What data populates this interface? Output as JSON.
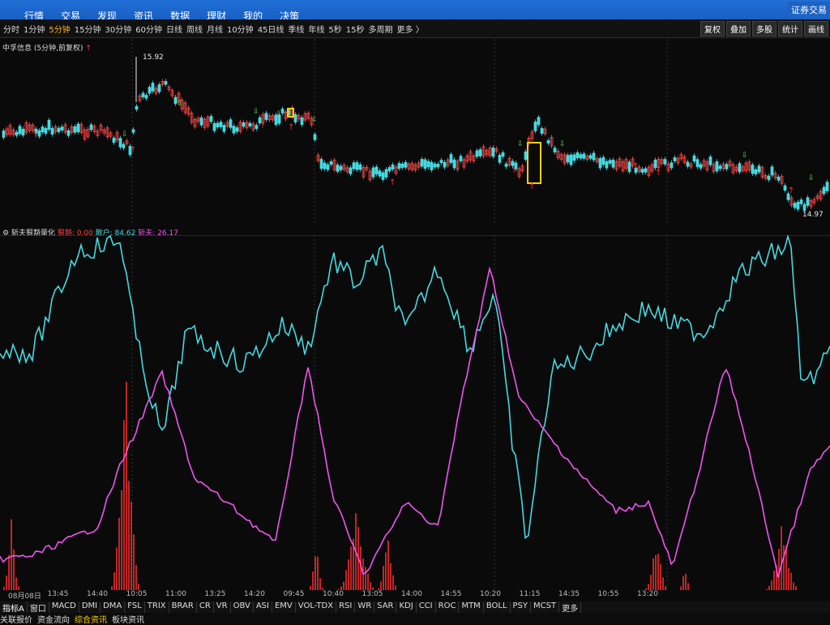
{
  "app": {
    "menu": [
      "行情",
      "交易",
      "发现",
      "资讯",
      "数据",
      "理财",
      "我的",
      "决策"
    ],
    "brand": "证券交易"
  },
  "toolbar": {
    "periods": [
      "分时",
      "1分钟",
      "5分钟",
      "15分钟",
      "30分钟",
      "60分钟",
      "日线",
      "周线",
      "月线",
      "10分钟",
      "45日线",
      "季线",
      "年线",
      "5秒",
      "15秒",
      "多周期",
      "更多 〉"
    ],
    "active_period": "5分钟",
    "right_buttons": [
      "复权",
      "叠加",
      "多股",
      "统计",
      "画线"
    ]
  },
  "kline": {
    "title": "中孚信息 (5分钟,前复权)",
    "up_arrow": "↑",
    "high_label": "15.92",
    "low_label": "14.97"
  },
  "indicator": {
    "name": "斩夫狠豁量化",
    "v1_label": "狠豁: 0.00",
    "v2_label": "散户: 84.62",
    "v3_label": "斩夫: 26.17",
    "colors": {
      "v1": "#ff3030",
      "v2": "#45d9e0",
      "v3": "#ee55ee"
    }
  },
  "time_axis": [
    "08月08日",
    "13:45",
    "14:40",
    "10:05",
    "11:00",
    "13:25",
    "14:20",
    "09:45",
    "10:40",
    "13:05",
    "14:00",
    "14:55",
    "10:20",
    "11:15",
    "14:35",
    "10:55",
    "13:20"
  ],
  "tabs": [
    "指标A",
    "窗口",
    "MACD",
    "DMI",
    "DMA",
    "FSL",
    "TRIX",
    "BRAR",
    "CR",
    "VR",
    "OBV",
    "ASI",
    "EMV",
    "VOL-TDX",
    "RSI",
    "WR",
    "SAR",
    "KDJ",
    "CCI",
    "ROC",
    "MTM",
    "BOLL",
    "PSY",
    "MCST",
    "更多"
  ],
  "bottom": [
    "关联报价",
    "资金流向",
    "综合资讯",
    "板块资讯"
  ],
  "bottom_active": "综合资讯"
}
